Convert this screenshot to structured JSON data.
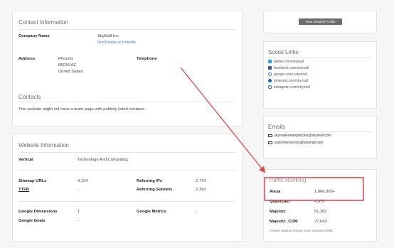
{
  "contact": {
    "title": "Contact Information",
    "company_label": "Company Name",
    "company_value": "SkyMall Inc",
    "linkedin_link": "Find People on LinkedIn",
    "address_label": "Address",
    "address_lines": [
      "Phoenix",
      "85034 AZ",
      "United States"
    ],
    "telephone_label": "Telephone",
    "contacts_heading": "Contacts",
    "contacts_text": "This website might not have a team page with publicly listed contacts."
  },
  "website": {
    "title": "Website Information",
    "vertical_label": "Vertical",
    "vertical_value": "Technology And Computing",
    "sitemap_label": "Sitemap URLs",
    "sitemap_value": "4,124",
    "ttfb_label": "TTFB",
    "ttfb_value": "-",
    "ref_ips_label": "Referring IPs",
    "ref_ips_value": "2,770",
    "ref_subnets_label": "Referring Subnets",
    "ref_subnets_value": "2,393",
    "gdim_label": "Google Dimensions",
    "gdim_value": "1",
    "ggoals_label": "Google Goals",
    "ggoals_value": "-",
    "gmetrics_label": "Google Metrics",
    "gmetrics_value": "-"
  },
  "profile": {
    "button_label": "View Detailed Profile"
  },
  "social": {
    "title": "Social Links",
    "items": [
      {
        "icon": "twitter-icon",
        "label": "twitter.com/skymall"
      },
      {
        "icon": "facebook-icon",
        "label": "facebook.com/skymall"
      },
      {
        "icon": "google-icon",
        "label": "google.com/+skymall"
      },
      {
        "icon": "linkedin-icon",
        "label": "pinterest.com/skymall"
      },
      {
        "icon": "instagram-icon",
        "label": "instagram.com/skymall"
      }
    ]
  },
  "emails": {
    "title": "Emails",
    "items": [
      "skymallenewspolicies@skymall.com",
      "customerservice@skymall.com"
    ]
  },
  "traffic": {
    "title": "Traffic Ranking",
    "rows": [
      {
        "label": "Alexa",
        "value": "1,000,000+"
      },
      {
        "label": "Quantcast",
        "value": "4,970"
      },
      {
        "label": "Majestic",
        "value": "51,382"
      },
      {
        "label": "Majestic .COM",
        "value": "27,643"
      }
    ],
    "note": "A lower ranking means more domains traffic."
  },
  "colors": {
    "highlight_red": "#e0323f",
    "arrow_red": "#e14545",
    "link_blue": "#3a78c2",
    "button_gray": "#6b6b6b"
  }
}
